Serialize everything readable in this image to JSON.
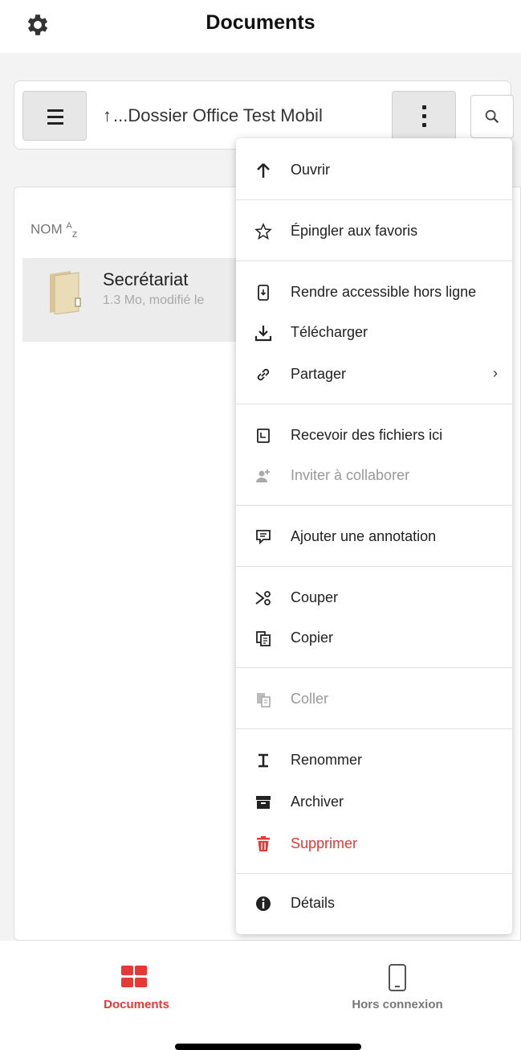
{
  "header": {
    "title": "Documents",
    "settings_icon": "gear-icon"
  },
  "toolbar": {
    "menu_icon": "hamburger-icon",
    "breadcrumb_arrow": "↑",
    "breadcrumb": "...Dossier Office Test Mobil",
    "more_icon": "vertical-dots-icon",
    "search_icon": "search-icon"
  },
  "list": {
    "column_header": "NOM",
    "sort_superscript": "A",
    "sort_subscript": "z",
    "rows": [
      {
        "name": "Secrétariat",
        "meta": "1.3 Mo, modifié le",
        "icon": "folder-icon"
      }
    ]
  },
  "context_menu": {
    "items": [
      {
        "label": "Ouvrir",
        "icon": "arrow-up-icon"
      },
      {
        "label": "Épingler aux favoris",
        "icon": "star-outline-icon"
      },
      {
        "label": "Rendre accessible hors ligne",
        "icon": "mobile-download-icon"
      },
      {
        "label": "Télécharger",
        "icon": "download-icon"
      },
      {
        "label": "Partager",
        "icon": "link-icon",
        "chevron": "›"
      },
      {
        "label": "Recevoir des fichiers ici",
        "icon": "inbox-icon"
      },
      {
        "label": "Inviter à collaborer",
        "icon": "add-user-icon",
        "disabled": true
      },
      {
        "label": "Ajouter une annotation",
        "icon": "comment-icon"
      },
      {
        "label": "Couper",
        "icon": "scissors-icon"
      },
      {
        "label": "Copier",
        "icon": "copy-icon"
      },
      {
        "label": "Coller",
        "icon": "paste-icon",
        "disabled": true
      },
      {
        "label": "Renommer",
        "icon": "text-cursor-icon"
      },
      {
        "label": "Archiver",
        "icon": "archive-icon"
      },
      {
        "label": "Supprimer",
        "icon": "trash-icon",
        "danger": true
      },
      {
        "label": "Détails",
        "icon": "info-icon"
      }
    ]
  },
  "bottom_nav": {
    "documents_label": "Documents",
    "offline_label": "Hors connexion",
    "documents_icon": "grid-icon",
    "offline_icon": "phone-icon"
  },
  "colors": {
    "accent": "#e53935",
    "disabled": "#999999",
    "selected_row": "#ececec"
  }
}
